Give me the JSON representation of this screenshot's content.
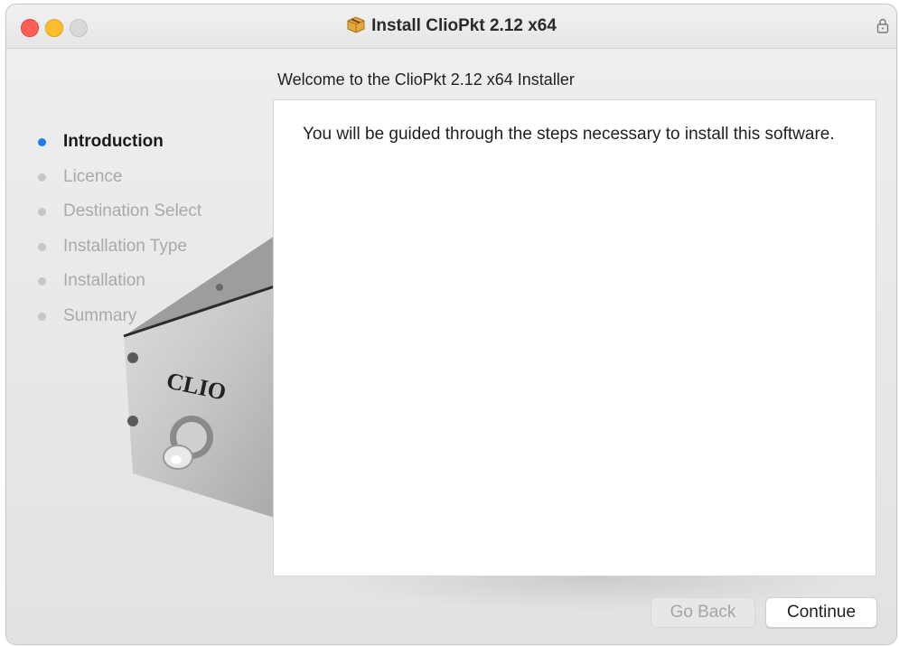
{
  "window": {
    "title": "Install ClioPkt 2.12 x64",
    "title_icon": "package-icon",
    "lock_icon": "lock-icon"
  },
  "heading": "Welcome to the ClioPkt 2.12 x64 Installer",
  "steps": [
    {
      "label": "Introduction",
      "active": true
    },
    {
      "label": "Licence",
      "active": false
    },
    {
      "label": "Destination Select",
      "active": false
    },
    {
      "label": "Installation Type",
      "active": false
    },
    {
      "label": "Installation",
      "active": false
    },
    {
      "label": "Summary",
      "active": false
    }
  ],
  "panel": {
    "text": "You will be guided through the steps necessary to install this software."
  },
  "background": {
    "device_label": "CLIO"
  },
  "buttons": {
    "back_label": "Go Back",
    "back_enabled": false,
    "continue_label": "Continue"
  },
  "colors": {
    "active_step": "#1a7cf0",
    "close": "#fe5f57",
    "minimize": "#febc2e",
    "zoom": "#d9d9d9"
  }
}
